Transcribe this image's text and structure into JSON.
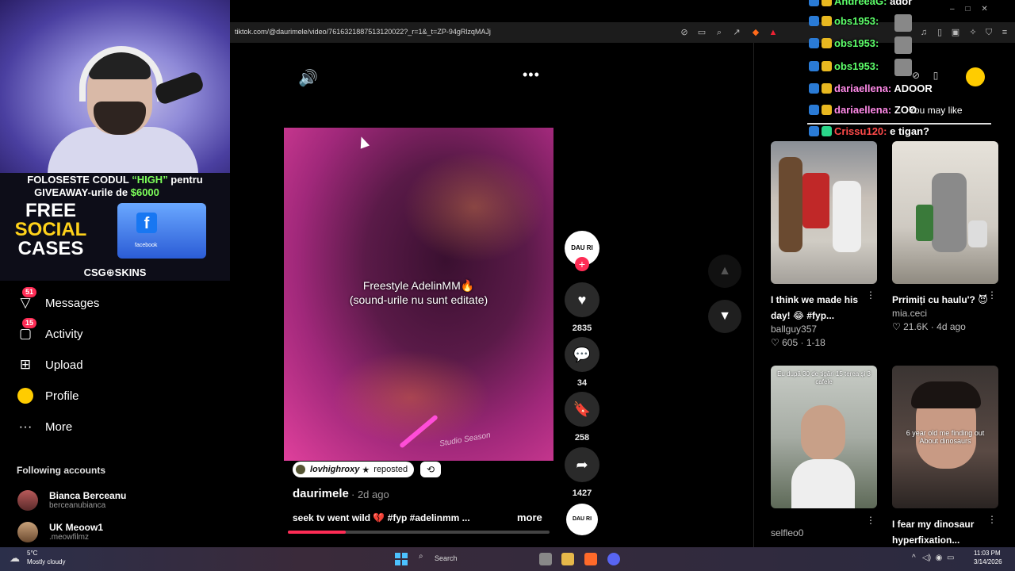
{
  "browser": {
    "url": "tiktok.com/@daurimele/video/7616321887513120022?_r=1&_t=ZP-94gRlzqMAJj"
  },
  "overlay": {
    "promo_line1_a": "FOLOSESTE CODUL ",
    "promo_code": "“HIGH”",
    "promo_line1_b": " pentru",
    "promo_line2_a": "GIVEAWAY-urile de ",
    "promo_amount": "$6000",
    "promo_free": "FREE",
    "promo_social": "SOCIAL",
    "promo_cases": "CASES",
    "promo_brand": "CSG⊕SKINS",
    "promo_fb_label": "facebook"
  },
  "sidebar": {
    "items": [
      {
        "label": "Messages",
        "badge": "51"
      },
      {
        "label": "Activity",
        "badge": "15"
      },
      {
        "label": "Upload"
      },
      {
        "label": "Profile"
      },
      {
        "label": "More"
      }
    ],
    "following_header": "Following accounts",
    "following": [
      {
        "name": "Bianca Berceanu",
        "handle": "berceanubianca"
      },
      {
        "name": "UK Meoow1",
        "handle": ".meowfilmz"
      }
    ]
  },
  "video": {
    "caption_line1": "Freestyle AdelinMM🔥",
    "caption_line2": "(sound-urile nu sunt editate)",
    "watermark": "Studio Season",
    "repost_user": "lovhighroxy",
    "repost_star": "★",
    "repost_text": "reposted",
    "author": "daurimele",
    "posted": "· 2d ago",
    "description": "seek tv went wild 💔 #fyp #adelinmm ...",
    "more_label": "more",
    "progress_fraction": 0.22,
    "creator_avatar_text": "DAU RI MELE",
    "music_disc_text": "DAU RI MELE"
  },
  "actions": {
    "likes": "2835",
    "comments": "34",
    "saves": "258",
    "shares": "1427"
  },
  "chat": {
    "lines": [
      {
        "user": "AndreeaG:",
        "msg": "ador",
        "color": "green"
      },
      {
        "user": "obs1953:",
        "msg": "",
        "color": "green"
      },
      {
        "user": "obs1953:",
        "msg": "",
        "color": "green"
      },
      {
        "user": "obs1953:",
        "msg": "",
        "color": "green"
      },
      {
        "user": "dariaellena:",
        "msg": "ADOOR",
        "color": "pink"
      },
      {
        "user": "dariaellena:",
        "msg": "ZOO",
        "color": "pink"
      },
      {
        "user": "Crissu120:",
        "msg": "e tigan?",
        "color": "red"
      }
    ],
    "caption_overlay": "You may like"
  },
  "recommended": [
    {
      "title": "I think we made his day! 😂 #fyp...",
      "user": "ballguy357",
      "likes": "605",
      "date": "1-18",
      "overlay": ""
    },
    {
      "title": "Prrimiți cu haulu'? 😈",
      "user": "mia.ceci",
      "likes": "21.6K",
      "date": "4d ago",
      "overlay": ""
    },
    {
      "title": "",
      "user": "selfleo0",
      "likes": "",
      "date": "",
      "overlay": "Eu după 30 de tigări 15 terea și 3 cafele"
    },
    {
      "title": "I fear my dinosaur hyperfixation...",
      "user": "",
      "likes": "",
      "date": "",
      "overlay": "6 year old me finding out About dinosaurs"
    }
  ],
  "taskbar": {
    "temp": "5°C",
    "weather": "Mostly cloudy",
    "search": "Search",
    "time": "11:03 PM",
    "date": "3/14/2026"
  },
  "colors": {
    "accent": "#fe2c55",
    "chat_green": "#5dff6a",
    "chat_pink": "#ff8ae8",
    "chat_red": "#ff4a4a"
  }
}
